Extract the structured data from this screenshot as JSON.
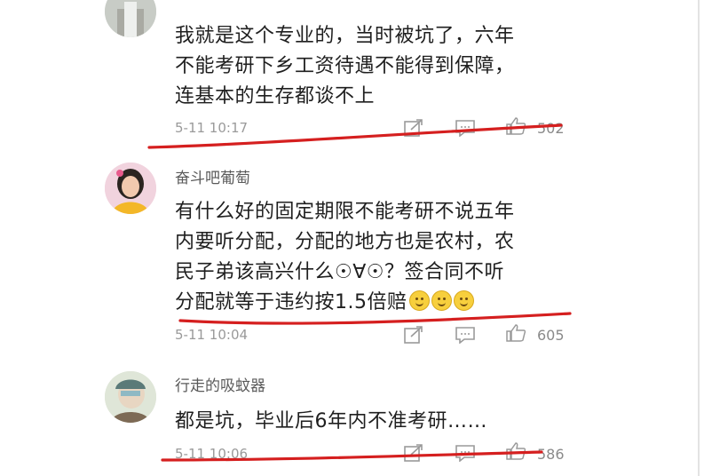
{
  "comments": [
    {
      "username": "",
      "lines": [
        "我就是这个专业的，当时被坑了，六年",
        "不能考研下乡工资待遇不能得到保障，",
        "连基本的生存都谈不上"
      ],
      "time": "5-11 10:17",
      "likes": "502"
    },
    {
      "username": "奋斗吧葡萄",
      "lines": [
        "有什么好的固定期限不能考研不说五年",
        "内要听分配，分配的地方也是农村，农",
        "民子弟该高兴什么☉∀☉？签合同不听",
        "分配就等于违约按1.5倍赔"
      ],
      "emoji_count": 3,
      "time": "5-11 10:04",
      "likes": "605"
    },
    {
      "username": "行走的吸蚊器",
      "lines": [
        "都是坑，毕业后6年内不准考研……"
      ],
      "time": "5-11 10:06",
      "likes": "586"
    }
  ],
  "icons": {
    "share": "share-icon",
    "reply": "comment-icon",
    "like": "thumbs-up-icon",
    "emoji": "smile-emoji-icon"
  },
  "colors": {
    "annotation_red": "#d51f1f",
    "meta_gray": "#9a9a9a",
    "text": "#1f1f1f"
  }
}
